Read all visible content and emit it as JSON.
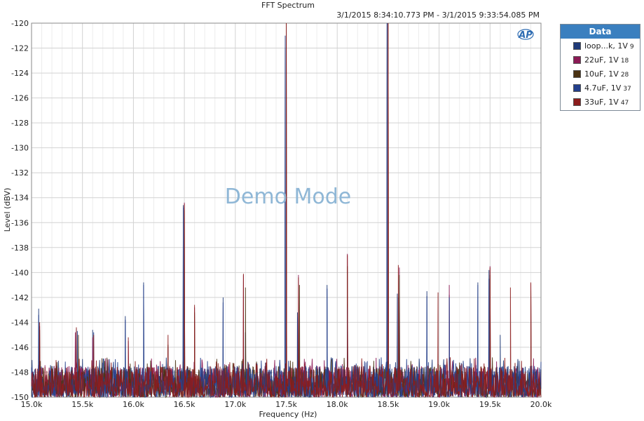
{
  "chart_data": {
    "type": "line",
    "title": "FFT Spectrum",
    "subtitle": "3/1/2015 8:34:10.773 PM - 3/1/2015 9:33:54.085 PM",
    "xlabel": "Frequency (Hz)",
    "ylabel": "Level (dBV)",
    "xlim": [
      15000,
      20000
    ],
    "ylim": [
      -150,
      -120
    ],
    "x_ticks": [
      {
        "value": 15000,
        "label": "15.0k"
      },
      {
        "value": 15500,
        "label": "15.5k"
      },
      {
        "value": 16000,
        "label": "16.0k"
      },
      {
        "value": 16500,
        "label": "16.5k"
      },
      {
        "value": 17000,
        "label": "17.0k"
      },
      {
        "value": 17500,
        "label": "17.5k"
      },
      {
        "value": 18000,
        "label": "18.0k"
      },
      {
        "value": 18500,
        "label": "18.5k"
      },
      {
        "value": 19000,
        "label": "19.0k"
      },
      {
        "value": 19500,
        "label": "19.5k"
      },
      {
        "value": 20000,
        "label": "20.0k"
      }
    ],
    "y_ticks": [
      {
        "value": -120,
        "label": "-120"
      },
      {
        "value": -122,
        "label": "-122"
      },
      {
        "value": -124,
        "label": "-124"
      },
      {
        "value": -126,
        "label": "-126"
      },
      {
        "value": -128,
        "label": "-128"
      },
      {
        "value": -130,
        "label": "-130"
      },
      {
        "value": -132,
        "label": "-132"
      },
      {
        "value": -134,
        "label": "-134"
      },
      {
        "value": -136,
        "label": "-136"
      },
      {
        "value": -138,
        "label": "-138"
      },
      {
        "value": -140,
        "label": "-140"
      },
      {
        "value": -142,
        "label": "-142"
      },
      {
        "value": -144,
        "label": "-144"
      },
      {
        "value": -146,
        "label": "-146"
      },
      {
        "value": -148,
        "label": "-148"
      },
      {
        "value": -150,
        "label": "-150"
      }
    ],
    "grid": true,
    "legend_position": "right",
    "legend_title": "Data",
    "noise_floor": [
      -150,
      -147.5
    ],
    "series": [
      {
        "name": "loop...k, 1V",
        "index": "9",
        "color": "#1f3a78",
        "peaks": [
          [
            15070,
            -142.9
          ],
          [
            15440,
            -144.5
          ],
          [
            15600,
            -144.6
          ],
          [
            15920,
            -143.5
          ],
          [
            16100,
            -140.8
          ],
          [
            16490,
            -134.6
          ],
          [
            16880,
            -142.0
          ],
          [
            17100,
            -144.8
          ],
          [
            17490,
            -122.0
          ],
          [
            17610,
            -143.2
          ],
          [
            17900,
            -141.0
          ],
          [
            18100,
            -142.5
          ],
          [
            18490,
            -120.0
          ],
          [
            18590,
            -141.7
          ],
          [
            18880,
            -141.5
          ],
          [
            19100,
            -141.8
          ],
          [
            19380,
            -140.8
          ],
          [
            19490,
            -139.8
          ],
          [
            19600,
            -145.0
          ]
        ]
      },
      {
        "name": "22uF, 1V",
        "index": "18",
        "color": "#8b1a55",
        "peaks": [
          [
            15080,
            -144.3
          ],
          [
            15430,
            -144.8
          ],
          [
            15600,
            -145.2
          ],
          [
            15950,
            -145.5
          ],
          [
            16340,
            -146.0
          ],
          [
            16500,
            -134.4
          ],
          [
            16600,
            -142.8
          ],
          [
            17080,
            -140.2
          ],
          [
            17500,
            -120.0
          ],
          [
            17620,
            -140.2
          ],
          [
            18100,
            -138.5
          ],
          [
            18500,
            -120.0
          ],
          [
            18610,
            -139.6
          ],
          [
            19100,
            -141.0
          ],
          [
            19500,
            -139.5
          ],
          [
            19900,
            -140.9
          ]
        ]
      },
      {
        "name": "10uF, 1V",
        "index": "28",
        "color": "#4a3212",
        "peaks": [
          [
            15080,
            -144.6
          ],
          [
            15460,
            -145.0
          ],
          [
            16340,
            -145.8
          ],
          [
            16500,
            -135.0
          ],
          [
            16600,
            -143.2
          ],
          [
            17100,
            -141.2
          ],
          [
            17500,
            -120.0
          ],
          [
            17630,
            -141.0
          ],
          [
            18100,
            -139.5
          ],
          [
            18500,
            -120.0
          ],
          [
            18610,
            -140.2
          ],
          [
            19500,
            -140.2
          ],
          [
            19900,
            -141.5
          ]
        ]
      },
      {
        "name": "4.7uF, 1V",
        "index": "37",
        "color": "#233f8c",
        "peaks": [
          [
            15070,
            -143.4
          ],
          [
            15450,
            -144.7
          ],
          [
            15610,
            -144.8
          ],
          [
            15920,
            -143.8
          ],
          [
            16100,
            -141.0
          ],
          [
            16490,
            -134.8
          ],
          [
            16880,
            -142.4
          ],
          [
            17490,
            -121.0
          ],
          [
            17610,
            -143.6
          ],
          [
            17900,
            -141.3
          ],
          [
            18100,
            -142.8
          ],
          [
            18490,
            -120.0
          ],
          [
            18600,
            -142.0
          ],
          [
            18880,
            -141.9
          ],
          [
            19100,
            -142.0
          ],
          [
            19380,
            -141.0
          ],
          [
            19490,
            -140.5
          ]
        ]
      },
      {
        "name": "33uF, 1V",
        "index": "47",
        "color": "#8c1c1c",
        "peaks": [
          [
            15080,
            -144.0
          ],
          [
            15440,
            -144.4
          ],
          [
            15610,
            -145.0
          ],
          [
            15950,
            -145.2
          ],
          [
            16340,
            -145.0
          ],
          [
            16500,
            -134.5
          ],
          [
            16600,
            -142.6
          ],
          [
            17080,
            -140.1
          ],
          [
            17500,
            -120.0
          ],
          [
            17620,
            -140.4
          ],
          [
            18100,
            -138.6
          ],
          [
            18500,
            -120.0
          ],
          [
            18600,
            -139.4
          ],
          [
            18990,
            -141.6
          ],
          [
            19500,
            -139.6
          ],
          [
            19700,
            -141.2
          ],
          [
            19900,
            -140.8
          ]
        ]
      }
    ]
  },
  "watermark": "Demo Mode",
  "logo_text": "AP"
}
